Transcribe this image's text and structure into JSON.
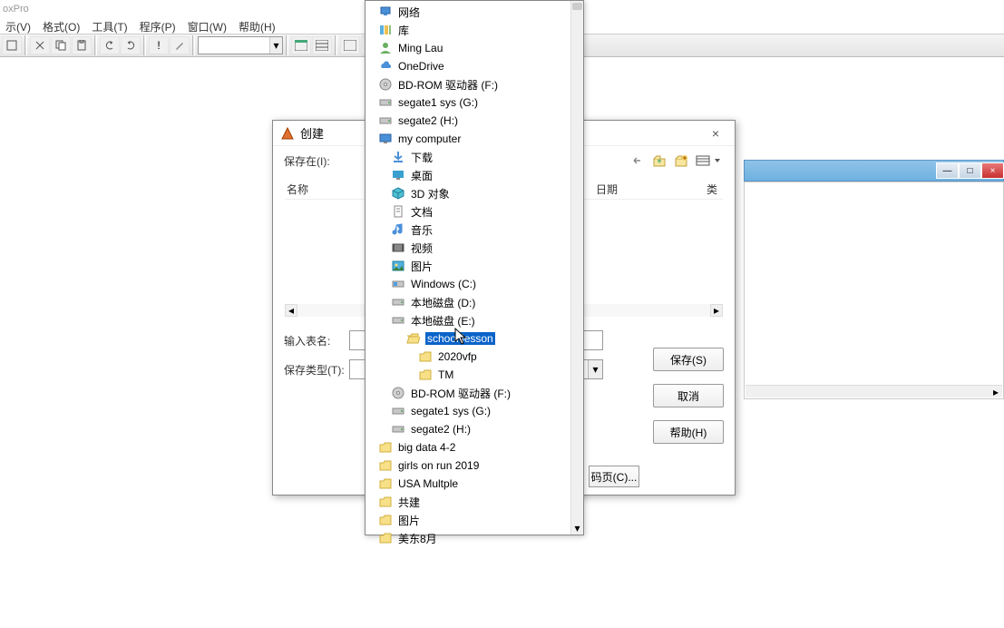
{
  "app": {
    "title": "oxPro"
  },
  "menu": {
    "view": "示(V)",
    "format": "格式(O)",
    "tools": "工具(T)",
    "program": "程序(P)",
    "window": "窗口(W)",
    "help": "帮助(H)"
  },
  "dialog": {
    "title": "创建",
    "save_in_label": "保存在(I):",
    "name_label": "名称",
    "date_label": "日期",
    "type_label": "类",
    "table_name_label": "输入表名:",
    "save_type_label": "保存类型(T):",
    "btn_save": "保存(S)",
    "btn_cancel": "取消",
    "btn_help": "帮助(H)",
    "codepage": "码页(C)...",
    "close": "×"
  },
  "tree": [
    {
      "i": 1,
      "icon": "network",
      "label": "网络"
    },
    {
      "i": 1,
      "icon": "library",
      "label": "库"
    },
    {
      "i": 1,
      "icon": "user",
      "label": "Ming Lau"
    },
    {
      "i": 1,
      "icon": "cloud",
      "label": "OneDrive"
    },
    {
      "i": 1,
      "icon": "disc",
      "label": "BD-ROM 驱动器 (F:)"
    },
    {
      "i": 1,
      "icon": "drive",
      "label": "segate1 sys (G:)"
    },
    {
      "i": 1,
      "icon": "drive",
      "label": "segate2 (H:)"
    },
    {
      "i": 1,
      "icon": "monitor",
      "label": "my computer"
    },
    {
      "i": 2,
      "icon": "download",
      "label": "下载"
    },
    {
      "i": 2,
      "icon": "desktop",
      "label": "桌面"
    },
    {
      "i": 2,
      "icon": "cube",
      "label": "3D 对象"
    },
    {
      "i": 2,
      "icon": "doc",
      "label": "文档"
    },
    {
      "i": 2,
      "icon": "music",
      "label": "音乐"
    },
    {
      "i": 2,
      "icon": "video",
      "label": "视频"
    },
    {
      "i": 2,
      "icon": "picture",
      "label": "图片"
    },
    {
      "i": 2,
      "icon": "win",
      "label": "Windows (C:)"
    },
    {
      "i": 2,
      "icon": "drive",
      "label": "本地磁盘 (D:)"
    },
    {
      "i": 2,
      "icon": "drive",
      "label": "本地磁盘 (E:)"
    },
    {
      "i": 3,
      "icon": "folder-open",
      "label": "school lesson",
      "sel": true
    },
    {
      "i": 4,
      "icon": "folder",
      "label": "2020vfp"
    },
    {
      "i": 4,
      "icon": "folder",
      "label": "TM"
    },
    {
      "i": 2,
      "icon": "disc",
      "label": "BD-ROM 驱动器 (F:)"
    },
    {
      "i": 2,
      "icon": "drive",
      "label": "segate1 sys (G:)"
    },
    {
      "i": 2,
      "icon": "drive",
      "label": "segate2 (H:)"
    },
    {
      "i": 1,
      "icon": "folder",
      "label": "big data 4-2"
    },
    {
      "i": 1,
      "icon": "folder",
      "label": "girls on run 2019"
    },
    {
      "i": 1,
      "icon": "folder",
      "label": "USA Multple"
    },
    {
      "i": 1,
      "icon": "folder",
      "label": "共建"
    },
    {
      "i": 1,
      "icon": "folder",
      "label": "图片"
    },
    {
      "i": 1,
      "icon": "folder",
      "label": "美东8月"
    }
  ],
  "bg_window": {
    "minimize": "—",
    "maximize": "□",
    "close": "×"
  }
}
